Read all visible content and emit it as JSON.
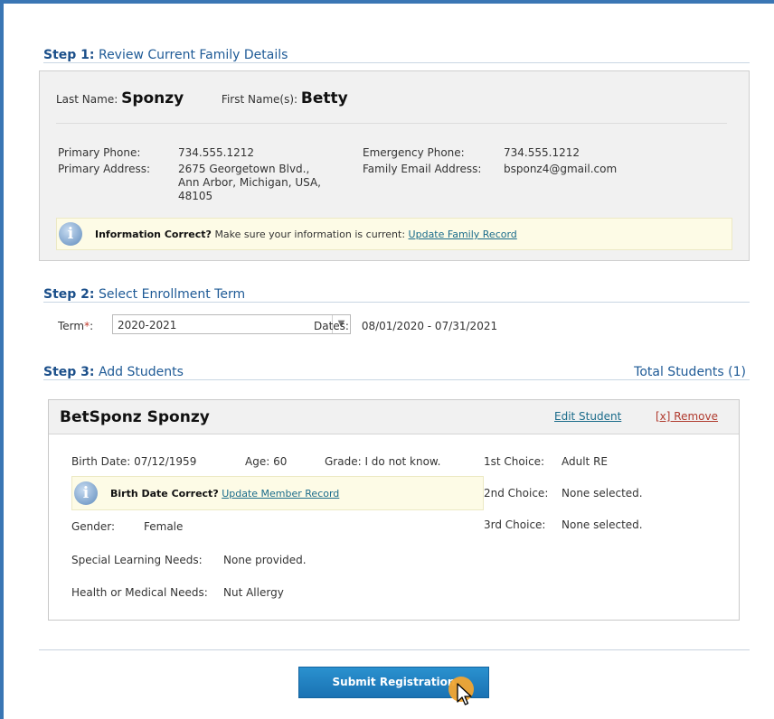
{
  "step1": {
    "number": "Step 1:",
    "title": "Review Current Family Details",
    "last_name_label": "Last Name:",
    "last_name": "Sponzy",
    "first_name_label": "First Name(s):",
    "first_name": "Betty",
    "primary_phone_label": "Primary Phone:",
    "primary_phone": "734.555.1212",
    "primary_address_label": "Primary Address:",
    "address_line1": "2675 Georgetown Blvd.,",
    "address_line2": "Ann Arbor, Michigan, USA,",
    "address_line3": "48105",
    "emergency_phone_label": "Emergency Phone:",
    "emergency_phone": "734.555.1212",
    "email_label": "Family Email Address:",
    "email": "bsponz4@gmail.com",
    "info_bold": "Information Correct?",
    "info_text": "Make sure your information is current:",
    "info_link": "Update Family Record"
  },
  "step2": {
    "number": "Step 2:",
    "title": "Select Enrollment Term",
    "term_label": "Term",
    "term_required": "*",
    "term_colon": ":",
    "term_value": "2020-2021",
    "dates_label": "Dates:",
    "dates_value": "08/01/2020 - 07/31/2021"
  },
  "step3": {
    "number": "Step 3:",
    "title": "Add Students",
    "total_students": "Total Students (1)"
  },
  "student": {
    "name": "BetSponz Sponzy",
    "edit_label": "Edit Student",
    "remove_label": "[x] Remove",
    "birth_date": "Birth Date:  07/12/1959",
    "age": "Age: 60",
    "grade": "Grade: I do not know.",
    "birth_bold": "Birth Date Correct?",
    "birth_link": "Update Member Record",
    "gender_label": "Gender:",
    "gender": "Female",
    "special_label": "Special Learning Needs:",
    "special": "None provided.",
    "health_label": "Health or Medical Needs:",
    "health": "Nut Allergy",
    "choice1_label": "1st Choice:",
    "choice1": "Adult RE",
    "choice2_label": "2nd Choice:",
    "choice2": "None selected.",
    "choice3_label": "3rd Choice:",
    "choice3": "None selected."
  },
  "submit_label": "Submit Registration",
  "icons": {
    "info": "info-icon",
    "dropdown": "chevron-down-icon",
    "cursor": "mouse-pointer-icon"
  },
  "colors": {
    "frame": "#3a76b4",
    "heading": "#1b4f8a",
    "button": "#1a72b3",
    "link": "#1a6b8a",
    "remove": "#b03a2e",
    "cursor_highlight": "#f2a531"
  }
}
